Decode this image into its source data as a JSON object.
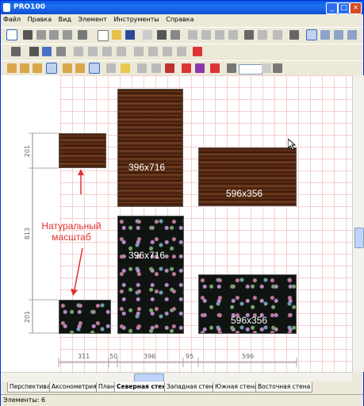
{
  "window": {
    "title": "PRO100"
  },
  "menu": [
    "Файл",
    "Правка",
    "Вид",
    "Элемент",
    "Инструменты",
    "Справка"
  ],
  "canvas": {
    "panels": [
      {
        "id": "small-wood",
        "texture": "wood",
        "label": ""
      },
      {
        "id": "tall-wood",
        "texture": "wood",
        "label": "396x716"
      },
      {
        "id": "wide-wood",
        "texture": "wood",
        "label": "596x356"
      },
      {
        "id": "tall-floral",
        "texture": "floral",
        "label": "396x716"
      },
      {
        "id": "small-floral",
        "texture": "floral",
        "label": ""
      },
      {
        "id": "wide-floral",
        "texture": "floral",
        "label": "596x356"
      }
    ],
    "annotation": {
      "line1": "Натуральный",
      "line2": "масштаб",
      "color": "#e23030"
    },
    "vertical_dims": [
      "201",
      "813",
      "201"
    ],
    "horizontal_dims": [
      "311",
      "50",
      "396",
      "95",
      "596"
    ]
  },
  "tabs": [
    "Перспектива",
    "Аксонометрия",
    "План",
    "Северная стена",
    "Западная стена",
    "Южная стена",
    "Восточная стена"
  ],
  "status": {
    "text": "Элементы: 6"
  }
}
